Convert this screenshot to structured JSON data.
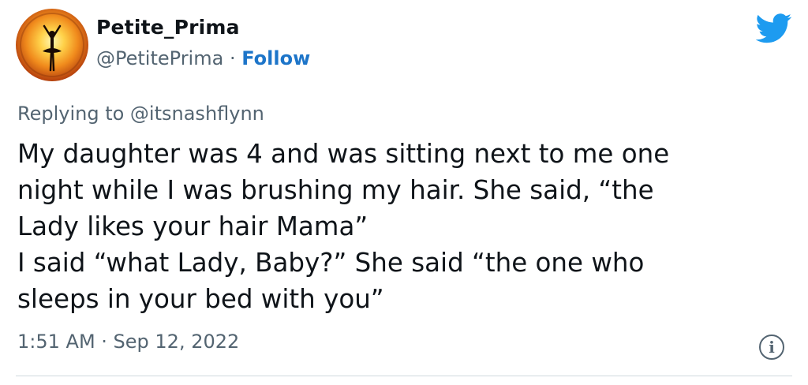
{
  "user": {
    "name": "Petite_Prima",
    "handle": "@PetitePrima",
    "separator": "·",
    "follow_label": "Follow"
  },
  "icons": {
    "brand": "twitter-bird-icon",
    "info": "info-icon",
    "brand_color": "#1d9bf0"
  },
  "tweet": {
    "replying_to": "Replying to @itsnashflynn",
    "lines": [
      "My daughter was 4 and was sitting next to me one",
      "night while I was brushing my hair. She said, “the",
      "Lady likes your hair Mama”",
      "I said “what Lady, Baby?” She said “the one who",
      "sleeps in your bed with you”"
    ],
    "timestamp": "1:51 AM · Sep 12, 2022",
    "info_glyph": "i"
  }
}
